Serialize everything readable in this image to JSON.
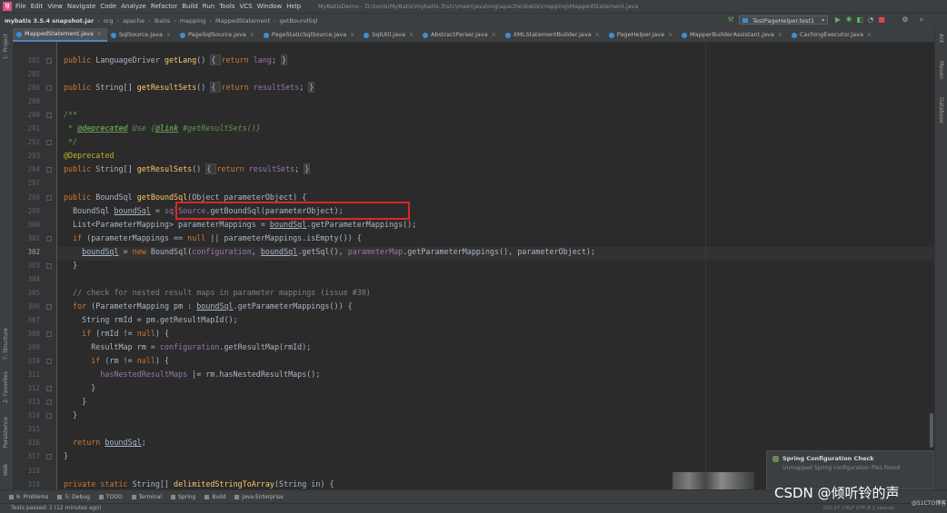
{
  "menubar": {
    "items": [
      "File",
      "Edit",
      "View",
      "Navigate",
      "Code",
      "Analyze",
      "Refactor",
      "Build",
      "Run",
      "Tools",
      "VCS",
      "Window",
      "Help"
    ],
    "window_title": "MyBatisDemo - D:\\tools\\MyBatis\\mybatis-3\\src\\main\\java\\org\\apache\\ibatis\\mapping\\MappedStatement.java"
  },
  "navbar": {
    "crumbs": [
      "mybatis 3.5.4 snapshot.jar",
      "org",
      "apache",
      "ibatis",
      "mapping",
      "MappedStatement",
      "getBoundSql"
    ],
    "run_config": "TestPageHelper.test1"
  },
  "tabs": [
    {
      "label": "MappedStatement.java",
      "active": true
    },
    {
      "label": "SqlSource.java",
      "active": false
    },
    {
      "label": "PageSqlSource.java",
      "active": false
    },
    {
      "label": "PageStaticSqlSource.java",
      "active": false
    },
    {
      "label": "SqlUtil.java",
      "active": false
    },
    {
      "label": "AbstractParser.java",
      "active": false
    },
    {
      "label": "XMLStatementBuilder.java",
      "active": false
    },
    {
      "label": "PageHelper.java",
      "active": false
    },
    {
      "label": "MapperBuilderAssistant.java",
      "active": false
    },
    {
      "label": "CachingExecutor.java",
      "active": false
    }
  ],
  "left_strip": [
    "1: Project",
    "7: Structure",
    "2: Favorites",
    "Persistence",
    "Web"
  ],
  "right_strip": [
    "Ant",
    "Maven",
    "Database"
  ],
  "line_numbers": [
    "282",
    "285",
    "286",
    "289",
    "290",
    "291",
    "292",
    "293",
    "294",
    "297",
    "298",
    "299",
    "300",
    "301",
    "302",
    "303",
    "304",
    "305",
    "306",
    "307",
    "308",
    "309",
    "310",
    "311",
    "312",
    "313",
    "314",
    "315",
    "316",
    "317",
    "318",
    "319"
  ],
  "current_line": "302",
  "code": [
    [
      [
        "kw",
        "public "
      ],
      [
        "t",
        "LanguageDriver "
      ],
      [
        "fn",
        "getLang"
      ],
      [
        "t",
        "() "
      ],
      [
        "fb",
        "{ "
      ],
      [
        "kw",
        "return "
      ],
      [
        "fd",
        "lang"
      ],
      [
        "t",
        "; "
      ],
      [
        "fb",
        "}"
      ]
    ],
    [],
    [
      [
        "kw",
        "public "
      ],
      [
        "t",
        "String[] "
      ],
      [
        "fn",
        "getResultSets"
      ],
      [
        "t",
        "() "
      ],
      [
        "fb",
        "{ "
      ],
      [
        "kw",
        "return "
      ],
      [
        "fd",
        "resultSets"
      ],
      [
        "t",
        "; "
      ],
      [
        "fb",
        "}"
      ]
    ],
    [],
    [
      [
        "dc",
        "/**"
      ]
    ],
    [
      [
        "dc",
        " * "
      ],
      [
        "dtag",
        "@deprecated"
      ],
      [
        "dc",
        " Use {"
      ],
      [
        "dtag",
        "@link"
      ],
      [
        "dc",
        " #getResultSets()}"
      ]
    ],
    [
      [
        "dc",
        " */"
      ]
    ],
    [
      [
        "an",
        "@Deprecated"
      ]
    ],
    [
      [
        "kw",
        "public "
      ],
      [
        "t",
        "String[] "
      ],
      [
        "fn",
        "getResulSets"
      ],
      [
        "t",
        "() "
      ],
      [
        "fb",
        "{ "
      ],
      [
        "kw",
        "return "
      ],
      [
        "fd",
        "resultSets"
      ],
      [
        "t",
        "; "
      ],
      [
        "fb",
        "}"
      ]
    ],
    [],
    [
      [
        "kw",
        "public "
      ],
      [
        "t",
        "BoundSql "
      ],
      [
        "fn",
        "getBoundSql"
      ],
      [
        "t",
        "(Object parameterObject) {"
      ]
    ],
    [
      [
        "t",
        "  BoundSql "
      ],
      [
        "ul",
        "boundSql"
      ],
      [
        "t",
        " = "
      ],
      [
        "fd",
        "sqlSource"
      ],
      [
        "t",
        ".getBoundSql(parameterObject);"
      ]
    ],
    [
      [
        "t",
        "  List<ParameterMapping> parameterMappings = "
      ],
      [
        "ul",
        "boundSql"
      ],
      [
        "t",
        ".getParameterMappings();"
      ]
    ],
    [
      [
        "kw",
        "  if "
      ],
      [
        "t",
        "(parameterMappings == "
      ],
      [
        "kw",
        "null"
      ],
      [
        "t",
        " || parameterMappings.isEmpty()) {"
      ]
    ],
    [
      [
        "t",
        "    "
      ],
      [
        "ul",
        "boundSql"
      ],
      [
        "t",
        " = "
      ],
      [
        "kw",
        "new "
      ],
      [
        "t",
        "BoundSql("
      ],
      [
        "fd",
        "configuration"
      ],
      [
        "t",
        ", "
      ],
      [
        "ul",
        "boundSql"
      ],
      [
        "t",
        ".getSql(), "
      ],
      [
        "fd",
        "parameterMap"
      ],
      [
        "t",
        ".getParameterMappings(), parameterObject);"
      ]
    ],
    [
      [
        "t",
        "  }"
      ]
    ],
    [],
    [
      [
        "cm",
        "  // check for nested result maps in parameter mappings (issue #30)"
      ]
    ],
    [
      [
        "kw",
        "  for "
      ],
      [
        "t",
        "(ParameterMapping pm : "
      ],
      [
        "ul",
        "boundSql"
      ],
      [
        "t",
        ".getParameterMappings()) {"
      ]
    ],
    [
      [
        "t",
        "    String rmId = pm.getResultMapId();"
      ]
    ],
    [
      [
        "kw",
        "    if "
      ],
      [
        "t",
        "(rmId != "
      ],
      [
        "kw",
        "null"
      ],
      [
        "t",
        ") {"
      ]
    ],
    [
      [
        "t",
        "      ResultMap rm = "
      ],
      [
        "fd",
        "configuration"
      ],
      [
        "t",
        ".getResultMap(rmId);"
      ]
    ],
    [
      [
        "kw",
        "      if "
      ],
      [
        "t",
        "(rm != "
      ],
      [
        "kw",
        "null"
      ],
      [
        "t",
        ") {"
      ]
    ],
    [
      [
        "fd",
        "        hasNestedResultMaps"
      ],
      [
        "t",
        " |= rm.hasNestedResultMaps();"
      ]
    ],
    [
      [
        "t",
        "      }"
      ]
    ],
    [
      [
        "t",
        "    }"
      ]
    ],
    [
      [
        "t",
        "  }"
      ]
    ],
    [],
    [
      [
        "kw",
        "  return "
      ],
      [
        "ul",
        "boundSql"
      ],
      [
        "t",
        ";"
      ]
    ],
    [
      [
        "t",
        "}"
      ]
    ],
    [],
    [
      [
        "kw",
        "private static "
      ],
      [
        "t",
        "String[] "
      ],
      [
        "fn",
        "delimitedStringToArray"
      ],
      [
        "t",
        "(String in) {"
      ]
    ]
  ],
  "notification": {
    "title": "Spring Configuration Check",
    "body": "Unmapped Spring configuration files found"
  },
  "toolwindows": [
    "6: Problems",
    "5: Debug",
    "TODO",
    "Terminal",
    "Spring",
    "Build",
    "Java Enterprise"
  ],
  "status": {
    "text": "Tests passed: 1 (12 minutes ago)",
    "position": "302:17   CRLF   UTF-8   2 spaces"
  },
  "watermark": {
    "text": "CSDN @倾听铃的声",
    "sub": "@51CTO博客"
  }
}
